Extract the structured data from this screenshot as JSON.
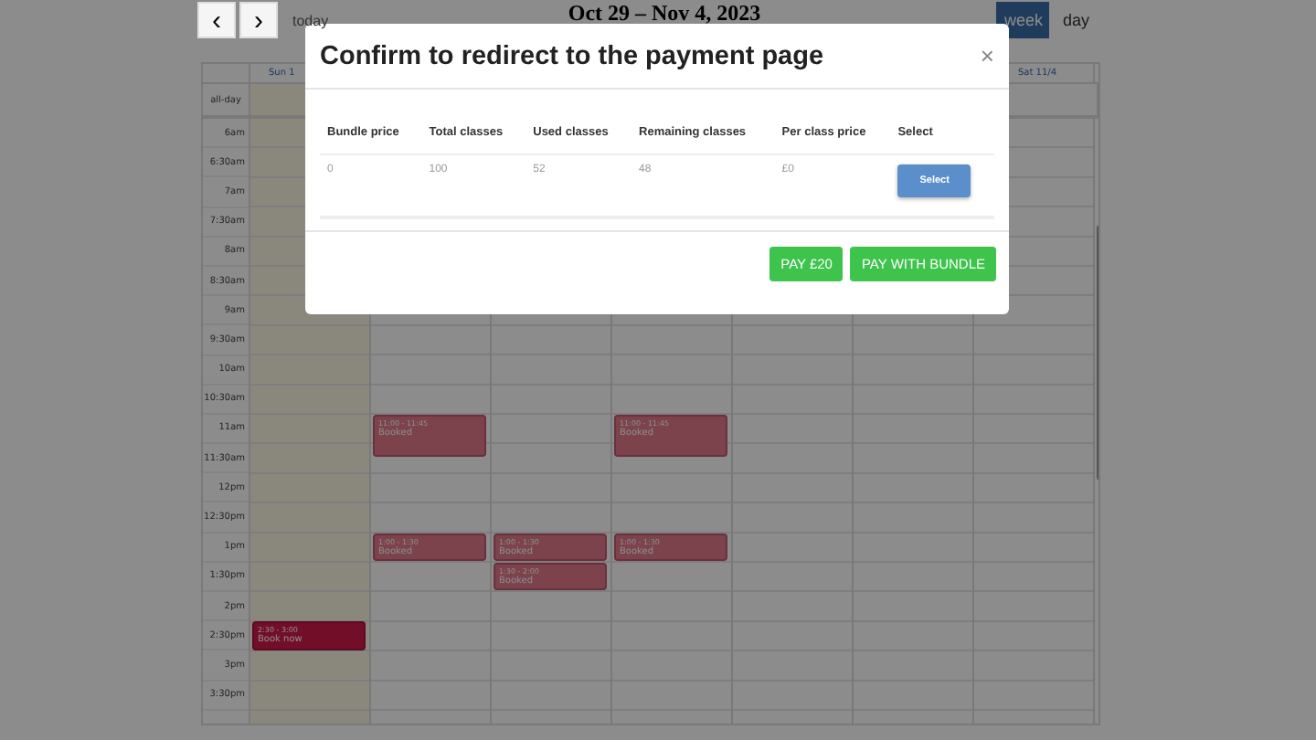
{
  "toolbar": {
    "prev": "‹",
    "next": "›",
    "today": "today",
    "title": "Oct 29 – Nov 4, 2023",
    "views": [
      {
        "label": "week",
        "selected": true
      },
      {
        "label": "day",
        "selected": false
      }
    ]
  },
  "calendar": {
    "all_day_label": "all-day",
    "times": [
      "6am",
      "6:30am",
      "7am",
      "7:30am",
      "8am",
      "8:30am",
      "9am",
      "9:30am",
      "10am",
      "10:30am",
      "11am",
      "11:30am",
      "12pm",
      "12:30pm",
      "1pm",
      "1:30pm",
      "2pm",
      "2:30pm",
      "3pm",
      "3:30pm"
    ],
    "days": [
      {
        "header": "Sun 1",
        "today": true,
        "events": [
          {
            "time": "2:30 - 3:00",
            "title": "Book now",
            "kind": "available"
          }
        ]
      },
      {
        "today": false,
        "events": [
          {
            "time": "11:00 - 11:45",
            "title": "Booked",
            "kind": "booked"
          },
          {
            "time": "1:00 - 1:30",
            "title": "Booked",
            "kind": "booked"
          }
        ]
      },
      {
        "today": false,
        "events": [
          {
            "time": "1:00 - 1:30",
            "title": "Booked",
            "kind": "booked"
          },
          {
            "time": "1:30 - 2:00",
            "title": "Booked",
            "kind": "booked"
          }
        ]
      },
      {
        "today": false,
        "events": [
          {
            "time": "11:00 - 11:45",
            "title": "Booked",
            "kind": "booked"
          },
          {
            "time": "1:00 - 1:30",
            "title": "Booked",
            "kind": "booked"
          }
        ]
      },
      {
        "today": false
      },
      {
        "today": false
      },
      {
        "header": "Sat 11/4",
        "today": false
      }
    ]
  },
  "modal": {
    "title": "Confirm to redirect to the payment page",
    "close": "×",
    "table": {
      "columns": [
        "Bundle price",
        "Total classes",
        "Used classes",
        "Remaining classes",
        "Per class price",
        "Select"
      ],
      "rows": [
        {
          "cells": [
            "0",
            "100",
            "52",
            "48",
            "£0"
          ],
          "button": "Select"
        }
      ]
    },
    "buttons": [
      "PAY £20",
      "PAY WITH BUNDLE"
    ]
  }
}
